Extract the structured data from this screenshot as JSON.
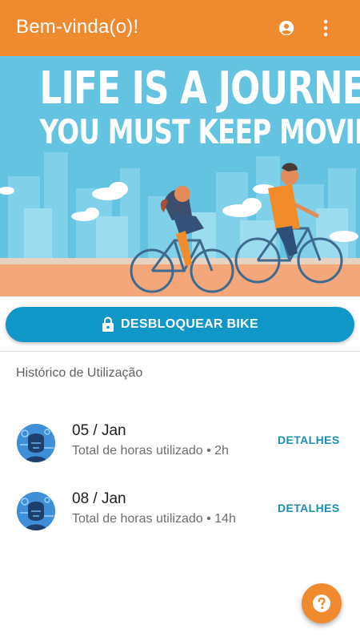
{
  "appbar": {
    "title": "Bem-vinda(o)!",
    "account_icon": "account-circle-icon",
    "more_icon": "more-vert-icon"
  },
  "banner": {
    "line1": "LIFE IS A JOURNEY",
    "line2": "YOU MUST KEEP MOVING"
  },
  "unlock": {
    "label": "DESBLOQUEAR BIKE",
    "icon": "lock-icon"
  },
  "history": {
    "title": "Histórico de Utilização",
    "items": [
      {
        "date": "05 / Jan",
        "subtitle": "Total de horas utilizado • 2h",
        "action": "DETALHES"
      },
      {
        "date": "08 / Jan",
        "subtitle": "Total de horas utilizado • 14h",
        "action": "DETALHES"
      }
    ]
  },
  "fab": {
    "icon": "help-icon"
  },
  "colors": {
    "primary": "#ef8a2f",
    "accent": "#1196c8",
    "banner_sky": "#63c3e0"
  }
}
